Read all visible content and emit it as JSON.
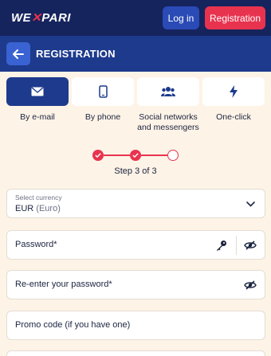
{
  "topbar": {
    "logo_left": "WE",
    "logo_x": "✕",
    "logo_right": "PARI",
    "login_label": "Log in",
    "registration_label": "Registration"
  },
  "header": {
    "title": "REGISTRATION"
  },
  "tabs": [
    {
      "label": "By e-mail",
      "icon": "envelope-icon",
      "active": true
    },
    {
      "label": "By phone",
      "icon": "phone-icon",
      "active": false
    },
    {
      "label": "Social networks and messengers",
      "icon": "users-icon",
      "active": false
    },
    {
      "label": "One-click",
      "icon": "lightning-icon",
      "active": false
    }
  ],
  "steps": {
    "current": 3,
    "total": 3,
    "text": "Step 3 of 3"
  },
  "form": {
    "currency": {
      "label": "Select currency",
      "code": "EUR",
      "name": "(Euro)"
    },
    "password_placeholder": "Password*",
    "repassword_placeholder": "Re-enter your password*",
    "promo_placeholder": "Promo code (if you have one)"
  },
  "colors": {
    "navy": "#16245e",
    "header_blue": "#1d3a8c",
    "accent_red": "#e8334f",
    "background": "#fdf3e6"
  }
}
